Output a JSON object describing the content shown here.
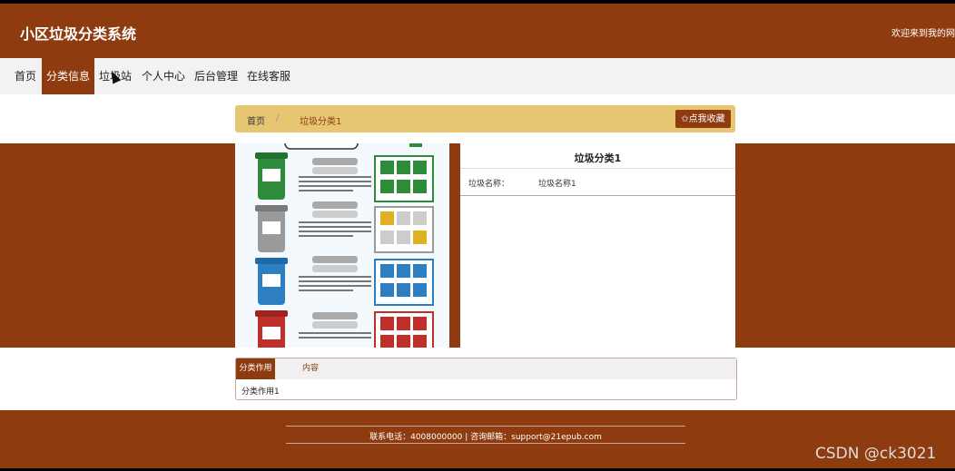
{
  "header": {
    "site_title": "小区垃圾分类系统",
    "welcome": "欢迎来到我的网站"
  },
  "nav": {
    "items": [
      {
        "label": "首页"
      },
      {
        "label": "分类信息"
      },
      {
        "label": "垃圾站"
      },
      {
        "label": "个人中心"
      },
      {
        "label": "后台管理"
      },
      {
        "label": "在线客服"
      }
    ],
    "active_index": 1
  },
  "breadcrumb": {
    "home": "首页",
    "separator": "/",
    "current": "垃圾分类1",
    "favorite_button": "✩点我收藏"
  },
  "detail": {
    "title": "垃圾分类1",
    "field_label": "垃圾名称：",
    "field_value": "垃圾名称1"
  },
  "tabs": {
    "items": [
      {
        "label": "分类作用"
      },
      {
        "label": "内容"
      }
    ],
    "content": "分类作用1"
  },
  "footer": {
    "contact": "联系电话：4008000000 | 咨询邮箱：support@21epub.com"
  },
  "watermark": "CSDN @ck3021",
  "colors": {
    "brand": "#8f3b10",
    "breadcrumb_bg": "#e6c672",
    "bin_green": "#2e8b3a",
    "bin_gray": "#9a9a9a",
    "bin_blue": "#2d7fc1",
    "bin_red": "#c0302b"
  }
}
